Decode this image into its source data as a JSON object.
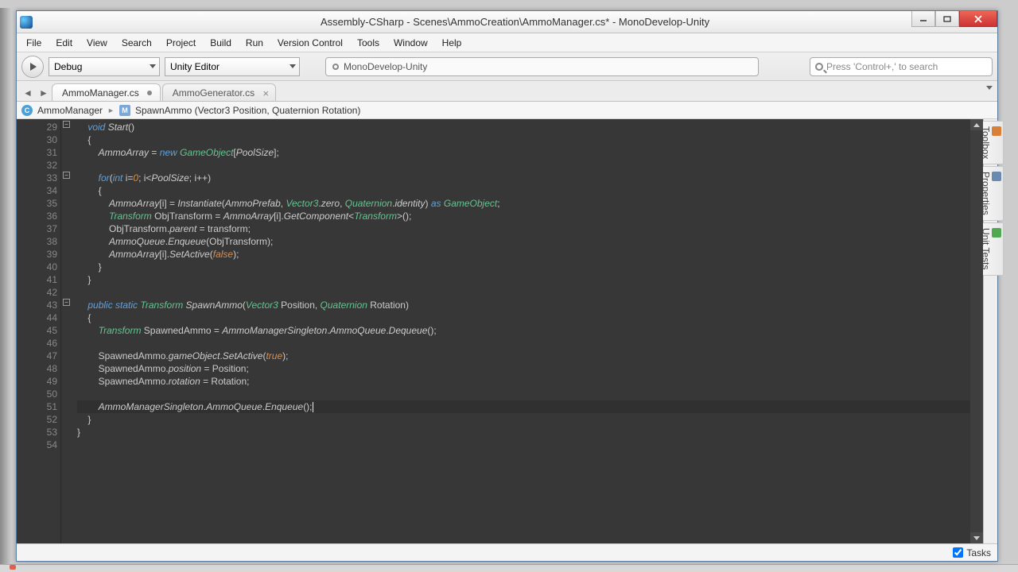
{
  "title": "Assembly-CSharp - Scenes\\AmmoCreation\\AmmoManager.cs* - MonoDevelop-Unity",
  "menubar": [
    "File",
    "Edit",
    "View",
    "Search",
    "Project",
    "Build",
    "Run",
    "Version Control",
    "Tools",
    "Window",
    "Help"
  ],
  "toolbar": {
    "config": "Debug",
    "target": "Unity Editor",
    "status": "MonoDevelop-Unity",
    "search_placeholder": "Press 'Control+,' to search"
  },
  "tabs": [
    {
      "label": "AmmoManager.cs",
      "dirty": true,
      "active": true
    },
    {
      "label": "AmmoGenerator.cs",
      "dirty": false,
      "active": false
    }
  ],
  "breadcrumb": {
    "class": "AmmoManager",
    "method": "SpawnAmmo (Vector3 Position, Quaternion Rotation)"
  },
  "side_panels": [
    "Toolbox",
    "Properties",
    "Unit Tests"
  ],
  "statusbar": {
    "tasks_label": "Tasks",
    "tasks_checked": true
  },
  "code": {
    "first_line": 29,
    "lines": [
      {
        "n": 29,
        "fold": "start",
        "tokens": [
          [
            "    ",
            ""
          ],
          [
            "void",
            "kw"
          ],
          [
            " ",
            ""
          ],
          [
            "Start",
            "ident"
          ],
          [
            "()",
            "punct"
          ]
        ]
      },
      {
        "n": 30,
        "tokens": [
          [
            "    {",
            ""
          ]
        ]
      },
      {
        "n": 31,
        "tokens": [
          [
            "        ",
            ""
          ],
          [
            "AmmoArray",
            "ident"
          ],
          [
            " = ",
            ""
          ],
          [
            "new",
            "kw"
          ],
          [
            " ",
            ""
          ],
          [
            "GameObject",
            "type"
          ],
          [
            "[",
            "punct"
          ],
          [
            "PoolSize",
            "ident"
          ],
          [
            "];",
            "punct"
          ]
        ]
      },
      {
        "n": 32,
        "tokens": [
          [
            "",
            ""
          ]
        ]
      },
      {
        "n": 33,
        "fold": "start",
        "tokens": [
          [
            "        ",
            ""
          ],
          [
            "for",
            "kw"
          ],
          [
            "(",
            "punct"
          ],
          [
            "int",
            "kw"
          ],
          [
            " i=",
            "punct"
          ],
          [
            "0",
            "lit"
          ],
          [
            "; i<",
            "punct"
          ],
          [
            "PoolSize",
            "ident"
          ],
          [
            "; i++)",
            "punct"
          ]
        ]
      },
      {
        "n": 34,
        "tokens": [
          [
            "        {",
            ""
          ]
        ]
      },
      {
        "n": 35,
        "tokens": [
          [
            "            ",
            ""
          ],
          [
            "AmmoArray",
            "ident"
          ],
          [
            "[i] = ",
            "punct"
          ],
          [
            "Instantiate",
            "ident"
          ],
          [
            "(",
            "punct"
          ],
          [
            "AmmoPrefab",
            "ident"
          ],
          [
            ", ",
            "punct"
          ],
          [
            "Vector3",
            "type"
          ],
          [
            ".",
            "punct"
          ],
          [
            "zero",
            "ident"
          ],
          [
            ", ",
            "punct"
          ],
          [
            "Quaternion",
            "type"
          ],
          [
            ".",
            "punct"
          ],
          [
            "identity",
            "ident"
          ],
          [
            ") ",
            "punct"
          ],
          [
            "as",
            "kw"
          ],
          [
            " ",
            "punct"
          ],
          [
            "GameObject",
            "type"
          ],
          [
            ";",
            "punct"
          ]
        ]
      },
      {
        "n": 36,
        "tokens": [
          [
            "            ",
            ""
          ],
          [
            "Transform",
            "type"
          ],
          [
            " ObjTransform = ",
            "punct"
          ],
          [
            "AmmoArray",
            "ident"
          ],
          [
            "[i].",
            "punct"
          ],
          [
            "GetComponent",
            "ident"
          ],
          [
            "<",
            "punct"
          ],
          [
            "Transform",
            "type"
          ],
          [
            ">();",
            "punct"
          ]
        ]
      },
      {
        "n": 37,
        "tokens": [
          [
            "            ObjTransform.",
            "punct"
          ],
          [
            "parent",
            "ident"
          ],
          [
            " = transform;",
            "punct"
          ]
        ]
      },
      {
        "n": 38,
        "tokens": [
          [
            "            ",
            ""
          ],
          [
            "AmmoQueue",
            "ident"
          ],
          [
            ".",
            "punct"
          ],
          [
            "Enqueue",
            "ident"
          ],
          [
            "(ObjTransform);",
            "punct"
          ]
        ]
      },
      {
        "n": 39,
        "tokens": [
          [
            "            ",
            ""
          ],
          [
            "AmmoArray",
            "ident"
          ],
          [
            "[i].",
            "punct"
          ],
          [
            "SetActive",
            "ident"
          ],
          [
            "(",
            "punct"
          ],
          [
            "false",
            "lit"
          ],
          [
            ");",
            "punct"
          ]
        ]
      },
      {
        "n": 40,
        "tokens": [
          [
            "        }",
            ""
          ]
        ]
      },
      {
        "n": 41,
        "tokens": [
          [
            "    }",
            ""
          ]
        ]
      },
      {
        "n": 42,
        "tokens": [
          [
            "",
            ""
          ]
        ]
      },
      {
        "n": 43,
        "fold": "start",
        "tokens": [
          [
            "    ",
            ""
          ],
          [
            "public",
            "kw"
          ],
          [
            " ",
            ""
          ],
          [
            "static",
            "kw"
          ],
          [
            " ",
            ""
          ],
          [
            "Transform",
            "type"
          ],
          [
            " ",
            ""
          ],
          [
            "SpawnAmmo",
            "ident"
          ],
          [
            "(",
            "punct"
          ],
          [
            "Vector3",
            "type"
          ],
          [
            " Position, ",
            "punct"
          ],
          [
            "Quaternion",
            "type"
          ],
          [
            " Rotation)",
            "punct"
          ]
        ]
      },
      {
        "n": 44,
        "tokens": [
          [
            "    {",
            ""
          ]
        ]
      },
      {
        "n": 45,
        "tokens": [
          [
            "        ",
            ""
          ],
          [
            "Transform",
            "type"
          ],
          [
            " SpawnedAmmo = ",
            "punct"
          ],
          [
            "AmmoManagerSingleton",
            "ident"
          ],
          [
            ".",
            "punct"
          ],
          [
            "AmmoQueue",
            "ident"
          ],
          [
            ".",
            "punct"
          ],
          [
            "Dequeue",
            "ident"
          ],
          [
            "();",
            "punct"
          ]
        ]
      },
      {
        "n": 46,
        "tokens": [
          [
            "",
            ""
          ]
        ]
      },
      {
        "n": 47,
        "tokens": [
          [
            "        SpawnedAmmo.",
            "punct"
          ],
          [
            "gameObject",
            "ident"
          ],
          [
            ".",
            "punct"
          ],
          [
            "SetActive",
            "ident"
          ],
          [
            "(",
            "punct"
          ],
          [
            "true",
            "lit"
          ],
          [
            ");",
            "punct"
          ]
        ]
      },
      {
        "n": 48,
        "tokens": [
          [
            "        SpawnedAmmo.",
            "punct"
          ],
          [
            "position",
            "ident"
          ],
          [
            " = Position;",
            "punct"
          ]
        ]
      },
      {
        "n": 49,
        "tokens": [
          [
            "        SpawnedAmmo.",
            "punct"
          ],
          [
            "rotation",
            "ident"
          ],
          [
            " = Rotation;",
            "punct"
          ]
        ]
      },
      {
        "n": 50,
        "tokens": [
          [
            "",
            ""
          ]
        ]
      },
      {
        "n": 51,
        "hl": true,
        "tokens": [
          [
            "        ",
            ""
          ],
          [
            "AmmoManagerSingleton",
            "ident"
          ],
          [
            ".",
            "punct"
          ],
          [
            "AmmoQueue",
            "ident"
          ],
          [
            ".",
            "punct"
          ],
          [
            "Enqueue",
            "ident"
          ],
          [
            "();",
            "punct"
          ]
        ],
        "cursor_after": true
      },
      {
        "n": 52,
        "tokens": [
          [
            "    }",
            ""
          ]
        ]
      },
      {
        "n": 53,
        "tokens": [
          [
            "}",
            ""
          ]
        ]
      },
      {
        "n": 54,
        "tokens": [
          [
            "",
            ""
          ]
        ]
      }
    ]
  }
}
